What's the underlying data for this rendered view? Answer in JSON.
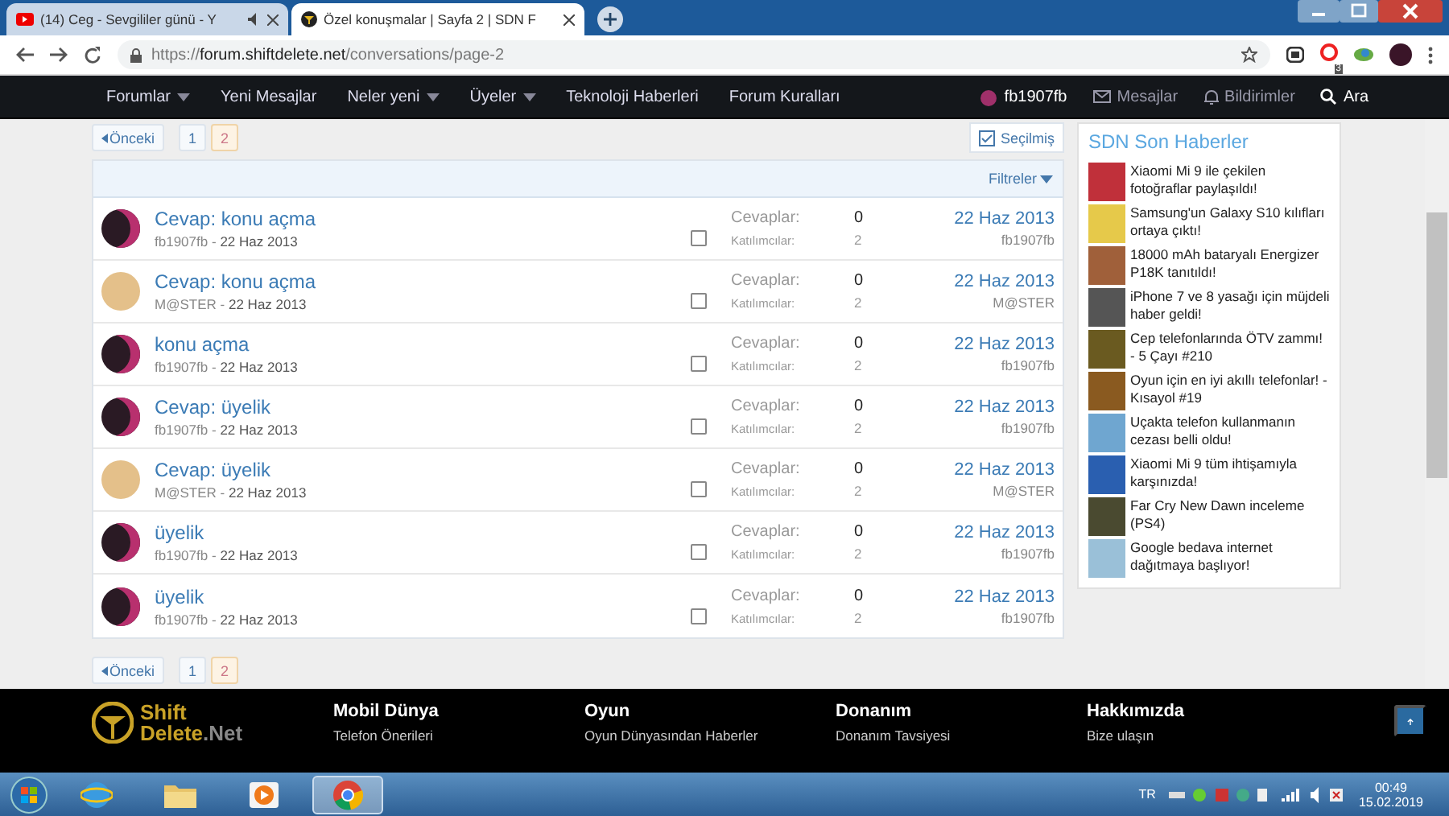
{
  "browser": {
    "tabs": [
      {
        "title": "(14) Ceg - Sevgililer günü - Y",
        "selected": false,
        "audio": true
      },
      {
        "title": "Özel konuşmalar | Sayfa 2 | SDN F",
        "selected": true,
        "audio": false
      }
    ],
    "url_scheme": "https://",
    "url_host": "forum.shiftdelete.net",
    "url_path": "/conversations/page-2",
    "extension_badge": "3"
  },
  "nav": {
    "items": [
      {
        "label": "Forumlar",
        "dropdown": true
      },
      {
        "label": "Yeni Mesajlar",
        "dropdown": false
      },
      {
        "label": "Neler yeni",
        "dropdown": true
      },
      {
        "label": "Üyeler",
        "dropdown": true
      },
      {
        "label": "Teknoloji Haberleri",
        "dropdown": false
      },
      {
        "label": "Forum Kuralları",
        "dropdown": false
      }
    ],
    "user": "fb1907fb",
    "messages": "Mesajlar",
    "alerts": "Bildirimler",
    "search": "Ara"
  },
  "pagination_top": {
    "prev": "Önceki",
    "pages": [
      {
        "label": "1",
        "selected": false
      },
      {
        "label": "2",
        "selected": true
      }
    ]
  },
  "starred_button": "Seçilmiş",
  "filters": "Filtreler",
  "conversations": [
    {
      "title": "Cevap: konu açma",
      "author": "fb1907fb",
      "separator": "-",
      "date": "22 Haz 2013",
      "kind": "dark",
      "checked": false,
      "replies_label": "Cevaplar:",
      "replies": "0",
      "participants_label": "Katılımcılar:",
      "participants": "2",
      "last_date": "22 Haz 2013",
      "last_user": "fb1907fb"
    },
    {
      "title": "Cevap: konu açma",
      "author": "M@STER",
      "separator": "-",
      "date": "22 Haz 2013",
      "kind": "light",
      "checked": false,
      "replies_label": "Cevaplar:",
      "replies": "0",
      "participants_label": "Katılımcılar:",
      "participants": "2",
      "last_date": "22 Haz 2013",
      "last_user": "M@STER"
    },
    {
      "title": "konu açma",
      "author": "fb1907fb",
      "separator": "-",
      "date": "22 Haz 2013",
      "kind": "dark",
      "checked": false,
      "replies_label": "Cevaplar:",
      "replies": "0",
      "participants_label": "Katılımcılar:",
      "participants": "2",
      "last_date": "22 Haz 2013",
      "last_user": "fb1907fb"
    },
    {
      "title": "Cevap: üyelik",
      "author": "fb1907fb",
      "separator": "-",
      "date": "22 Haz 2013",
      "kind": "dark",
      "checked": false,
      "replies_label": "Cevaplar:",
      "replies": "0",
      "participants_label": "Katılımcılar:",
      "participants": "2",
      "last_date": "22 Haz 2013",
      "last_user": "fb1907fb"
    },
    {
      "title": "Cevap: üyelik",
      "author": "M@STER",
      "separator": "-",
      "date": "22 Haz 2013",
      "kind": "light",
      "checked": false,
      "replies_label": "Cevaplar:",
      "replies": "0",
      "participants_label": "Katılımcılar:",
      "participants": "2",
      "last_date": "22 Haz 2013",
      "last_user": "M@STER"
    },
    {
      "title": "üyelik",
      "author": "fb1907fb",
      "separator": "-",
      "date": "22 Haz 2013",
      "kind": "dark",
      "checked": false,
      "replies_label": "Cevaplar:",
      "replies": "0",
      "participants_label": "Katılımcılar:",
      "participants": "2",
      "last_date": "22 Haz 2013",
      "last_user": "fb1907fb"
    },
    {
      "title": "üyelik",
      "author": "fb1907fb",
      "separator": "-",
      "date": "22 Haz 2013",
      "kind": "dark",
      "checked": false,
      "replies_label": "Cevaplar:",
      "replies": "0",
      "participants_label": "Katılımcılar:",
      "participants": "2",
      "last_date": "22 Haz 2013",
      "last_user": "fb1907fb"
    }
  ],
  "pagination_bottom": {
    "prev": "Önceki",
    "pages": [
      {
        "label": "1",
        "selected": false
      },
      {
        "label": "2",
        "selected": true
      }
    ]
  },
  "sidebar": {
    "title": "SDN Son Haberler",
    "news": [
      {
        "title": "Xiaomi Mi 9 ile çekilen fotoğraflar paylaşıldı!"
      },
      {
        "title": "Samsung'un Galaxy S10 kılıfları ortaya çıktı!"
      },
      {
        "title": "18000 mAh bataryalı Energizer P18K tanıtıldı!"
      },
      {
        "title": "iPhone 7 ve 8 yasağı için müjdeli haber geldi!"
      },
      {
        "title": "Cep telefonlarında ÖTV zammı! - 5 Çayı #210"
      },
      {
        "title": "Oyun için en iyi akıllı telefonlar! - Kısayol #19"
      },
      {
        "title": "Uçakta telefon kullanmanın cezası belli oldu!"
      },
      {
        "title": "Xiaomi Mi 9 tüm ihtişamıyla karşınızda!"
      },
      {
        "title": "Far Cry New Dawn inceleme (PS4)"
      },
      {
        "title": "Google bedava internet dağıtmaya başlıyor!"
      }
    ]
  },
  "footer": {
    "logo_top": "Shift",
    "logo_main": "Delete",
    "logo_suffix": ".Net",
    "columns": [
      {
        "heading": "Mobil Dünya",
        "link": "Telefon Önerileri"
      },
      {
        "heading": "Oyun",
        "link": "Oyun Dünyasından Haberler"
      },
      {
        "heading": "Donanım",
        "link": "Donanım Tavsiyesi"
      },
      {
        "heading": "Hakkımızda",
        "link": "Bize ulaşın"
      }
    ]
  },
  "taskbar": {
    "apps": [
      {
        "kind": "ie",
        "selected": false
      },
      {
        "kind": "folder",
        "selected": false
      },
      {
        "kind": "media",
        "selected": false
      },
      {
        "kind": "chrome",
        "selected": true
      }
    ],
    "language": "TR",
    "time": "00:49",
    "date": "15.02.2019"
  }
}
